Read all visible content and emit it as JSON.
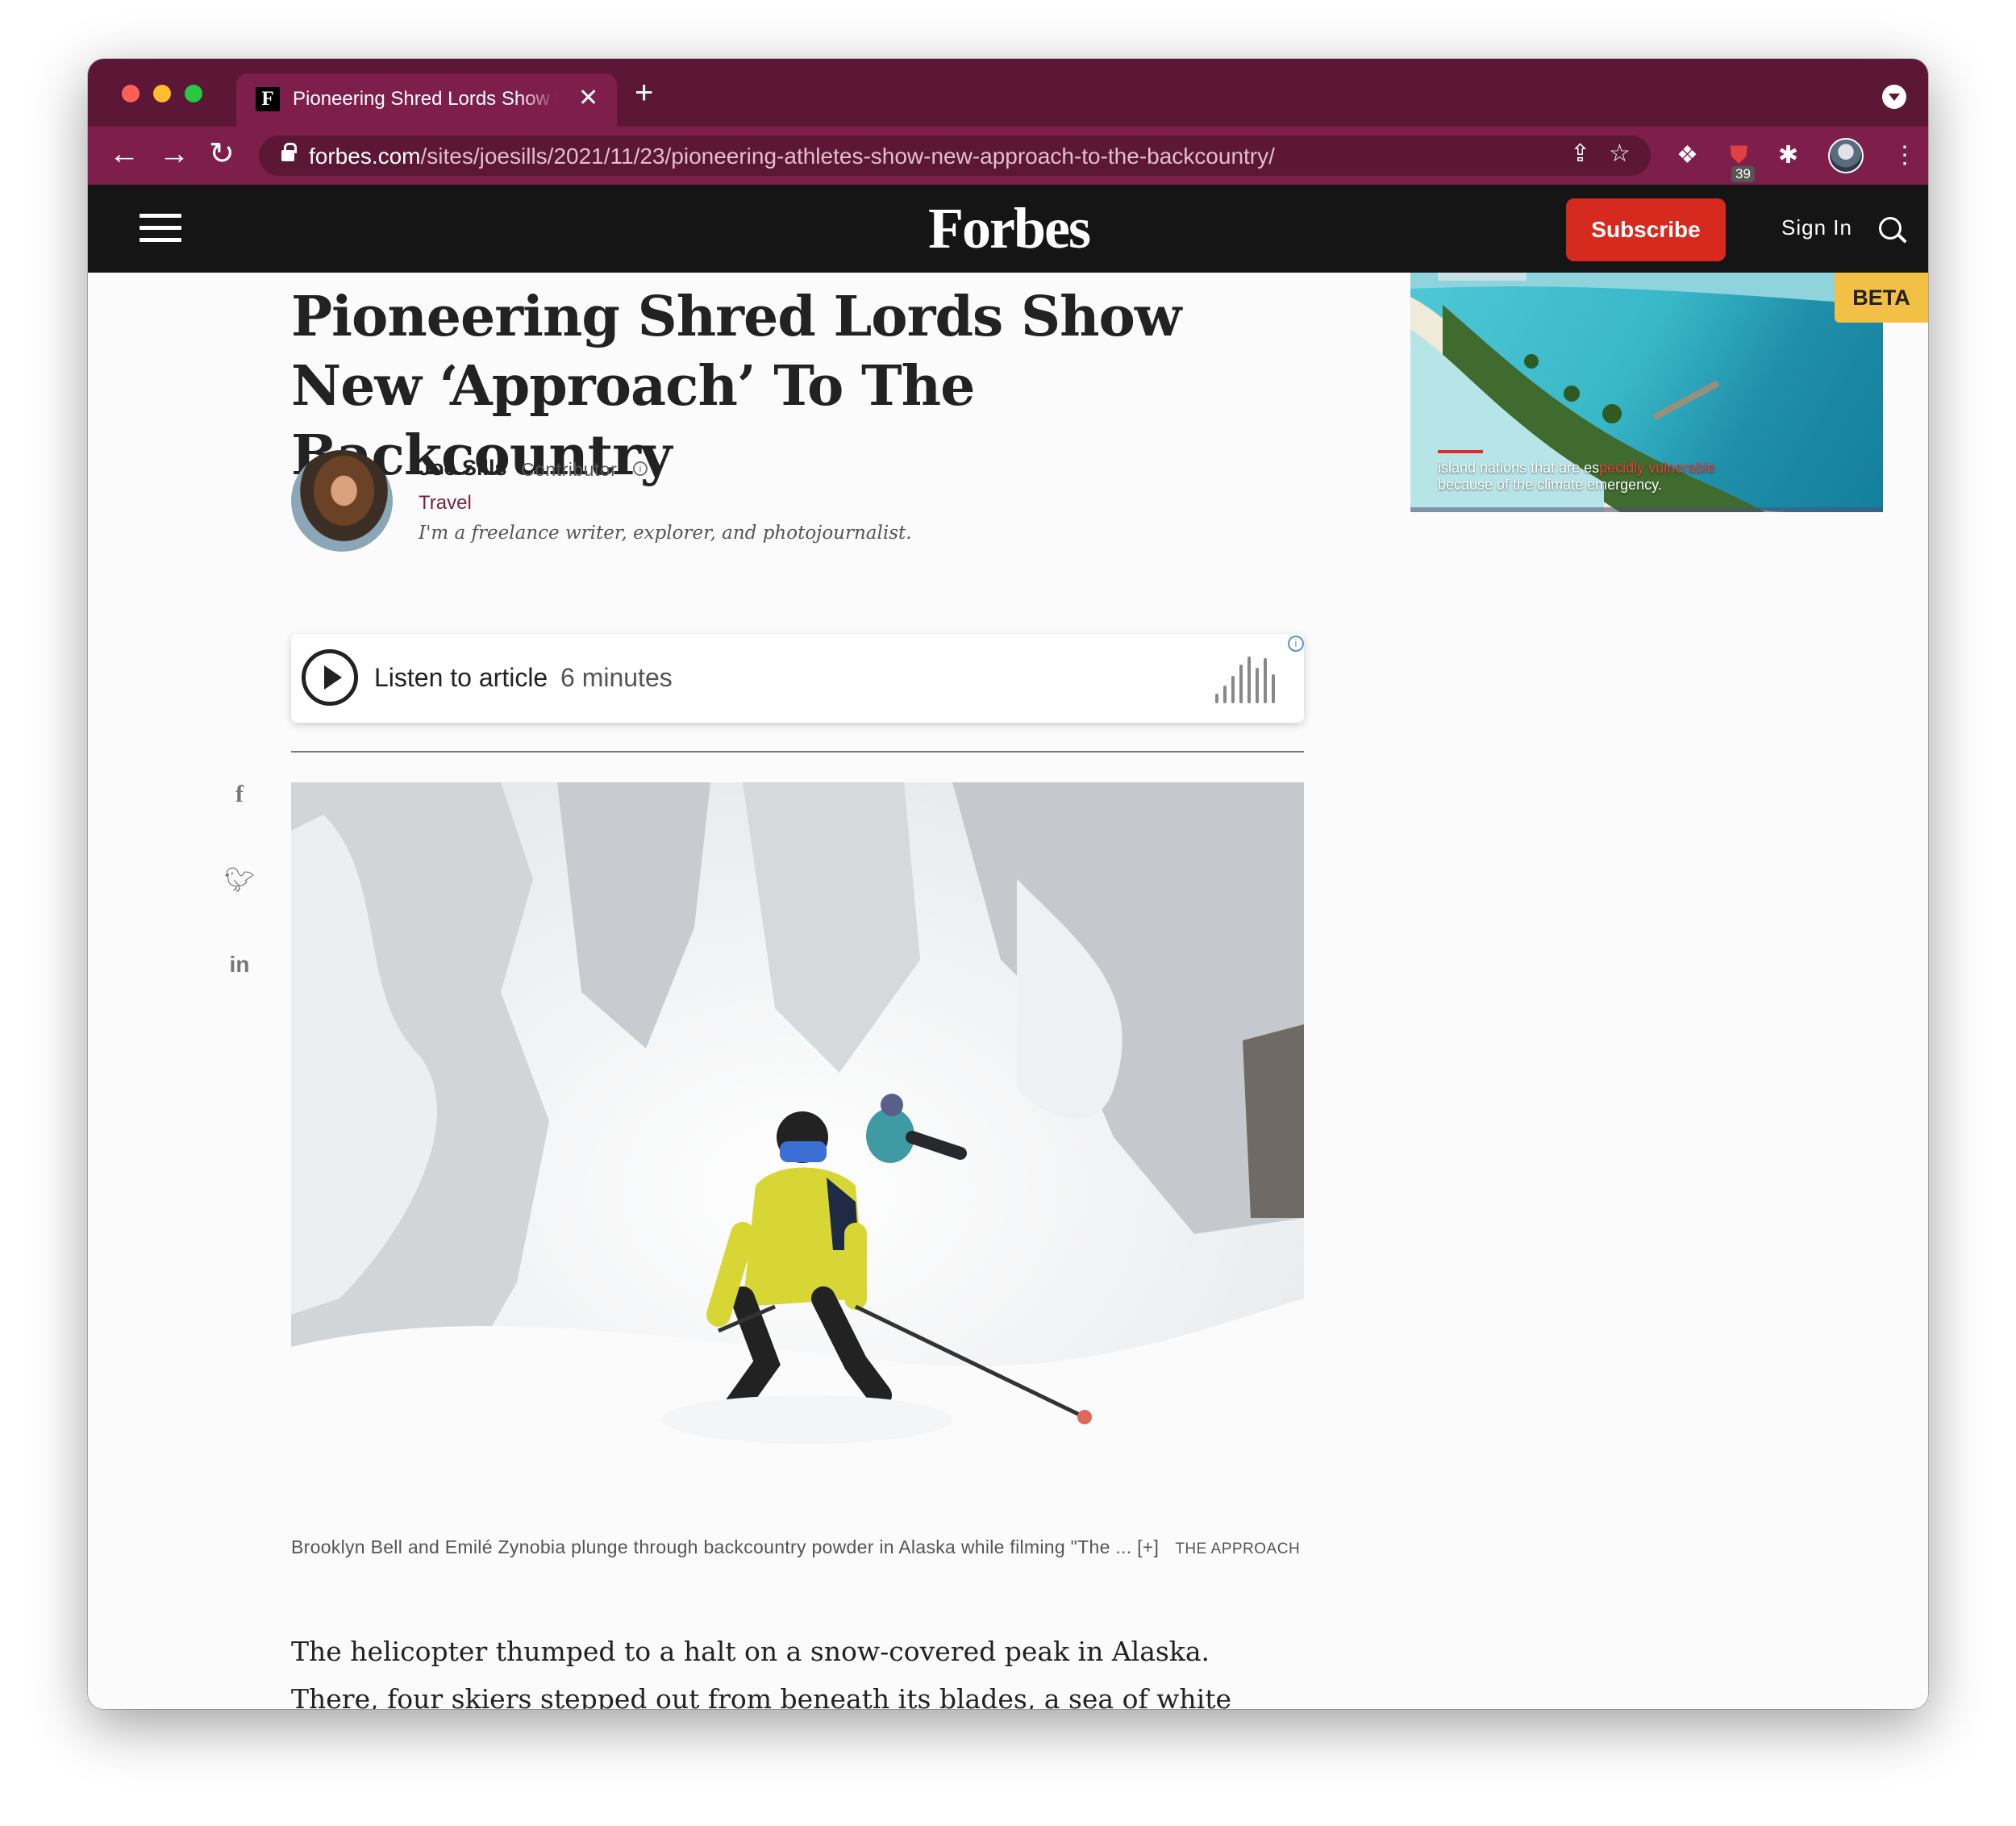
{
  "browser": {
    "tab_title": "Pioneering Shred Lords Show New ‘Approach’ To The Backcountry",
    "favicon_letter": "F",
    "url_domain": "forbes.com",
    "url_path": "/sites/joesills/2021/11/23/pioneering-athletes-show-new-approach-to-the-backcountry/",
    "extension_badge": "39"
  },
  "site": {
    "logo": "Forbes",
    "subscribe_label": "Subscribe",
    "signin_label": "Sign In"
  },
  "article": {
    "headline": "Pioneering Shred Lords Show New ‘Approach’ To The Backcountry",
    "author_name": "Joe Sills",
    "author_role": "Contributor",
    "section": "Travel",
    "author_bio": "I'm a freelance writer, explorer, and photojournalist.",
    "listen_label": "Listen to article",
    "listen_duration": "6 minutes",
    "image_caption": "Brooklyn Bell and Emilé Zynobia plunge through backcountry powder in Alaska while filming \"The ... [+]",
    "image_credit": "THE APPROACH",
    "body": "The helicopter thumped to a halt on a snow-covered peak in Alaska. There, four skiers stepped out from beneath its blades, a sea of white pinnacles in the background. In the blink of an eye, they were screeching downhill—plunging"
  },
  "ad": {
    "beta_label": "BETA",
    "caption_white_1": "island nations that are es",
    "caption_red": "pecidly vulnerable",
    "caption_line2": "because of the climate emergency."
  },
  "colors": {
    "tabstrip": "#5c1636",
    "toolbar": "#7e1e4a",
    "subscribe": "#d72a1e",
    "beta": "#f2c045",
    "section_link": "#7b1f3f"
  }
}
